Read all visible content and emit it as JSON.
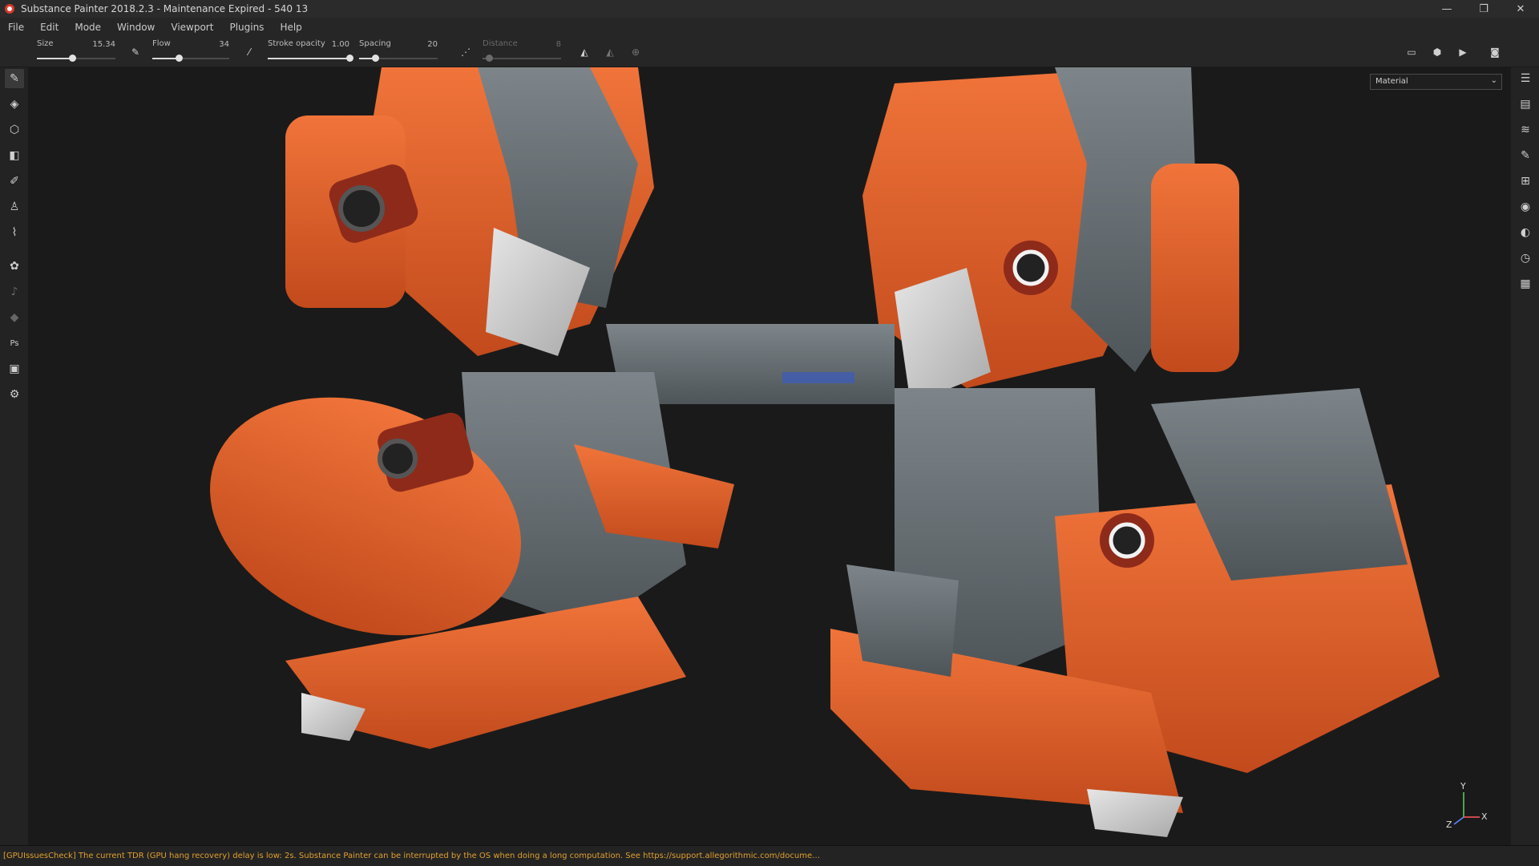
{
  "window": {
    "title": "Substance Painter 2018.2.3 - Maintenance Expired - 540 13",
    "controls": [
      "—",
      "❐",
      "✕"
    ]
  },
  "menu": [
    "File",
    "Edit",
    "Mode",
    "Window",
    "Viewport",
    "Plugins",
    "Help"
  ],
  "toolbar": {
    "size": {
      "label": "Size",
      "value": "15.34",
      "level": 0.45
    },
    "flow": {
      "label": "Flow",
      "value": "34",
      "level": 0.34
    },
    "stroke_opacity": {
      "label": "Stroke opacity",
      "value": "1.00",
      "level": 1.0
    },
    "spacing": {
      "label": "Spacing",
      "value": "20",
      "level": 0.2
    },
    "distance": {
      "label": "Distance",
      "value": "8",
      "level": 0.08,
      "enabled": false
    }
  },
  "viewport": {
    "channel_select": "Material",
    "axis_labels": {
      "y": "Y",
      "x": "X",
      "z": "Z"
    }
  },
  "status": {
    "message": "[GPUIssuesCheck] The current TDR (GPU hang recovery) delay is low: 2s. Substance Painter can be interrupted by the OS when doing a long computation. See https://support.allegorithmic.com/docume…"
  },
  "colors": {
    "orange": "#e4622a",
    "steel": "#6b7378",
    "status_warning": "#e0a030"
  }
}
